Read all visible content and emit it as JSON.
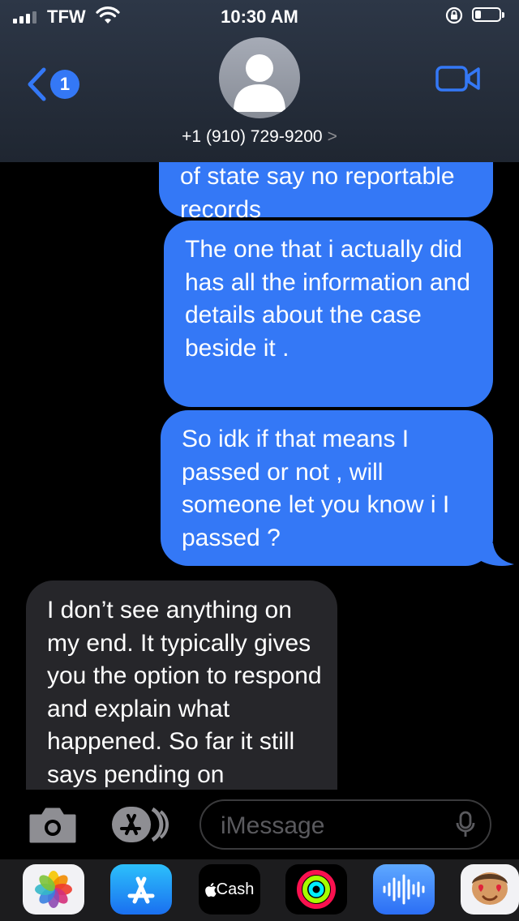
{
  "status_bar": {
    "carrier": "TFW",
    "time": "10:30 AM",
    "battery_level": 0.25
  },
  "header": {
    "unread_count": "1",
    "contact_name": "+1 (910) 729-9200",
    "contact_chevron": ">"
  },
  "messages": [
    {
      "direction": "sent",
      "text": "of state say no reportable records",
      "clipped": true
    },
    {
      "direction": "sent",
      "text": "The one that i actually did has all the information and details about the case beside it ."
    },
    {
      "direction": "sent",
      "text": "So idk if that means I passed or not , will someone let you know i I passed ?"
    },
    {
      "direction": "received",
      "text": "I don’t see anything on my end. It typically gives you the option to respond and explain what happened. So far it still says pending on",
      "clipped": true
    }
  ],
  "composer": {
    "placeholder": "iMessage"
  },
  "app_drawer": {
    "apps": [
      {
        "name": "Photos",
        "icon": "photos-icon"
      },
      {
        "name": "App Store",
        "icon": "app-store-icon"
      },
      {
        "name": "Cash",
        "label": "Cash",
        "icon": "apple-logo-icon"
      },
      {
        "name": "Fitness",
        "icon": "activity-rings-icon"
      },
      {
        "name": "Audio Message",
        "icon": "waveform-icon"
      },
      {
        "name": "Memoji",
        "icon": "memoji-icon"
      }
    ]
  },
  "colors": {
    "sent_bubble": "#3478f6",
    "received_bubble": "#26262a",
    "badge": "#3478f6",
    "header_bg": "#2a3342"
  }
}
